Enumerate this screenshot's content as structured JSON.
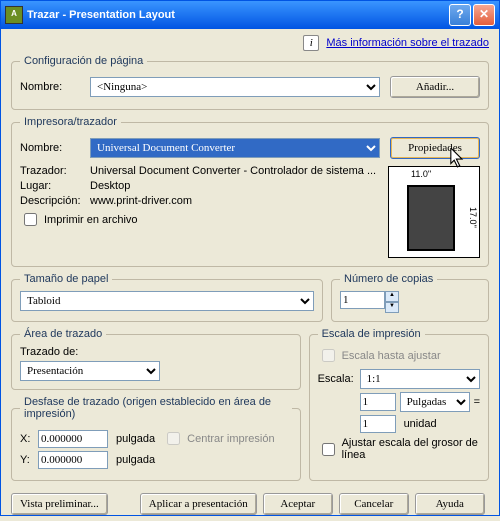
{
  "title": "Trazar - Presentation Layout",
  "info_link": "Más información sobre el trazado",
  "pageconf": {
    "legend": "Configuración de página",
    "nombre": "Nombre:",
    "value": "<Ninguna>",
    "add": "Añadir..."
  },
  "printer": {
    "legend": "Impresora/trazador",
    "nombre": "Nombre:",
    "value": "Universal Document Converter",
    "props": "Propiedades",
    "trazador_l": "Trazador:",
    "trazador_v": "Universal Document Converter - Controlador de sistema ...",
    "lugar_l": "Lugar:",
    "lugar_v": "Desktop",
    "desc_l": "Descripción:",
    "desc_v": "www.print-driver.com",
    "file": "Imprimir en archivo",
    "dim_w": "11.0''",
    "dim_h": "17.0''"
  },
  "paper": {
    "legend": "Tamaño de papel",
    "value": "Tabloid"
  },
  "copies": {
    "legend": "Número de copias",
    "value": "1"
  },
  "area": {
    "legend": "Área de trazado",
    "trazado": "Trazado de:",
    "value": "Presentación"
  },
  "scale": {
    "legend": "Escala de impresión",
    "fit": "Escala hasta ajustar",
    "escala_l": "Escala:",
    "escala_v": "1:1",
    "n1": "1",
    "unit1": "Pulgadas",
    "n2": "1",
    "unit2": "unidad",
    "lw": "Ajustar escala del grosor de línea"
  },
  "offset": {
    "legend": "Desfase de trazado (origen establecido en área de impresión)",
    "x": "X:",
    "xv": "0.000000",
    "y": "Y:",
    "yv": "0.000000",
    "u": "pulgada",
    "center": "Centrar impresión"
  },
  "btns": {
    "preview": "Vista preliminar...",
    "apply": "Aplicar a presentación",
    "ok": "Aceptar",
    "cancel": "Cancelar",
    "help": "Ayuda"
  }
}
